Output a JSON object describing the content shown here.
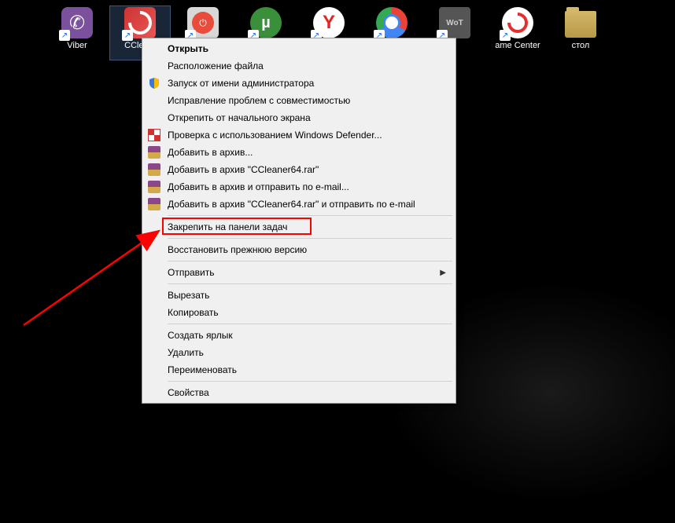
{
  "desktop": {
    "icons": [
      {
        "name": "viber",
        "label": "Viber",
        "shortcut": true
      },
      {
        "name": "ccleaner",
        "label": "CClea...",
        "shortcut": true,
        "selected": true
      },
      {
        "name": "shutdown",
        "label": "",
        "shortcut": true
      },
      {
        "name": "utorrent",
        "label": "",
        "shortcut": true
      },
      {
        "name": "yandex",
        "label": "",
        "shortcut": true
      },
      {
        "name": "chrome",
        "label": "",
        "shortcut": true
      },
      {
        "name": "wot",
        "label": "",
        "shortcut": true
      },
      {
        "name": "gamecenter",
        "label": "ame Center",
        "shortcut": true
      },
      {
        "name": "folder",
        "label": "стол",
        "shortcut": false
      }
    ]
  },
  "context_menu": {
    "items": [
      {
        "type": "item",
        "label": "Открыть",
        "bold": true
      },
      {
        "type": "item",
        "label": "Расположение файла"
      },
      {
        "type": "item",
        "label": "Запуск от имени администратора",
        "icon": "shield"
      },
      {
        "type": "item",
        "label": "Исправление проблем с совместимостью"
      },
      {
        "type": "item",
        "label": "Открепить от начального экрана"
      },
      {
        "type": "item",
        "label": "Проверка с использованием Windows Defender...",
        "icon": "defender"
      },
      {
        "type": "item",
        "label": "Добавить в архив...",
        "icon": "winrar"
      },
      {
        "type": "item",
        "label": "Добавить в архив \"CCleaner64.rar\"",
        "icon": "winrar"
      },
      {
        "type": "item",
        "label": "Добавить в архив и отправить по e-mail...",
        "icon": "winrar"
      },
      {
        "type": "item",
        "label": "Добавить в архив \"CCleaner64.rar\" и отправить по e-mail",
        "icon": "winrar"
      },
      {
        "type": "separator"
      },
      {
        "type": "item",
        "label": "Закрепить на панели задач",
        "highlighted": true
      },
      {
        "type": "separator"
      },
      {
        "type": "item",
        "label": "Восстановить прежнюю версию"
      },
      {
        "type": "separator"
      },
      {
        "type": "item",
        "label": "Отправить",
        "submenu": true
      },
      {
        "type": "separator"
      },
      {
        "type": "item",
        "label": "Вырезать"
      },
      {
        "type": "item",
        "label": "Копировать"
      },
      {
        "type": "separator"
      },
      {
        "type": "item",
        "label": "Создать ярлык"
      },
      {
        "type": "item",
        "label": "Удалить"
      },
      {
        "type": "item",
        "label": "Переименовать"
      },
      {
        "type": "separator"
      },
      {
        "type": "item",
        "label": "Свойства"
      }
    ]
  }
}
